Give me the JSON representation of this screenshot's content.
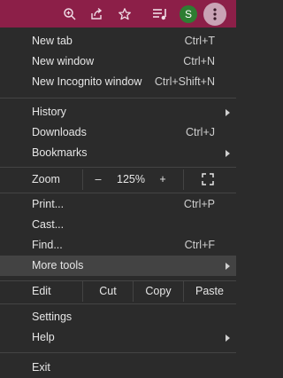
{
  "toolbar": {
    "zoom_icon": "zoom-in-icon",
    "share_icon": "share-icon",
    "bookmark_icon": "star-icon",
    "media_icon": "media-queue-icon",
    "profile_initial": "S",
    "menu_icon": "kebab-menu-icon",
    "accent_color": "#8c1f48"
  },
  "menu": {
    "new_tab": {
      "label": "New tab",
      "shortcut": "Ctrl+T"
    },
    "new_window": {
      "label": "New window",
      "shortcut": "Ctrl+N"
    },
    "new_incognito": {
      "label": "New Incognito window",
      "shortcut": "Ctrl+Shift+N"
    },
    "history": {
      "label": "History"
    },
    "downloads": {
      "label": "Downloads",
      "shortcut": "Ctrl+J"
    },
    "bookmarks": {
      "label": "Bookmarks"
    },
    "zoom": {
      "label": "Zoom",
      "minus": "–",
      "value": "125%",
      "plus": "+",
      "fullscreen_icon": "fullscreen-icon"
    },
    "print": {
      "label": "Print...",
      "shortcut": "Ctrl+P"
    },
    "cast": {
      "label": "Cast..."
    },
    "find": {
      "label": "Find...",
      "shortcut": "Ctrl+F"
    },
    "more_tools": {
      "label": "More tools"
    },
    "edit": {
      "label": "Edit",
      "cut": "Cut",
      "copy": "Copy",
      "paste": "Paste"
    },
    "settings": {
      "label": "Settings"
    },
    "help": {
      "label": "Help"
    },
    "exit": {
      "label": "Exit"
    }
  }
}
